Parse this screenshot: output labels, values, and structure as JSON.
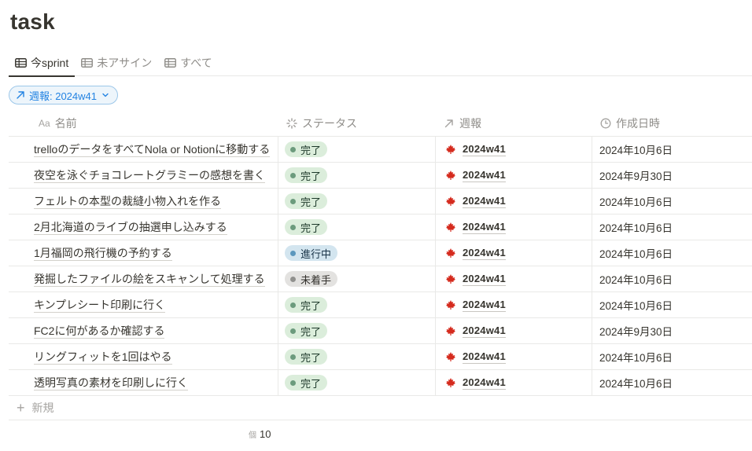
{
  "page": {
    "title": "task"
  },
  "tabs": [
    {
      "label": "今sprint",
      "active": true
    },
    {
      "label": "未アサイン",
      "active": false
    },
    {
      "label": "すべて",
      "active": false
    }
  ],
  "filter": {
    "label": "週報: 2024w41"
  },
  "columns": [
    {
      "icon": "Aa",
      "label": "名前"
    },
    {
      "icon": "status-icon",
      "label": "ステータス"
    },
    {
      "icon": "relation-arrow-icon",
      "label": "週報"
    },
    {
      "icon": "clock-icon",
      "label": "作成日時"
    }
  ],
  "status_colors": {
    "完了": {
      "bg": "#dbeddb",
      "dot": "#6c9b7d",
      "text": "#1c3829"
    },
    "進行中": {
      "bg": "#d3e5ef",
      "dot": "#5b97bd",
      "text": "#183347"
    },
    "未着手": {
      "bg": "#e3e2e0",
      "dot": "#91918e",
      "text": "#32302c"
    }
  },
  "rows": [
    {
      "name": "trelloのデータをすべてNola or Notionに移動する",
      "status": "完了",
      "report": "2024w41",
      "created": "2024年10月6日"
    },
    {
      "name": "夜空を泳ぐチョコレートグラミーの感想を書く",
      "status": "完了",
      "report": "2024w41",
      "created": "2024年9月30日"
    },
    {
      "name": "フェルトの本型の裁縫小物入れを作る",
      "status": "完了",
      "report": "2024w41",
      "created": "2024年10月6日"
    },
    {
      "name": "2月北海道のライブの抽選申し込みする",
      "status": "完了",
      "report": "2024w41",
      "created": "2024年10月6日"
    },
    {
      "name": "1月福岡の飛行機の予約する",
      "status": "進行中",
      "report": "2024w41",
      "created": "2024年10月6日"
    },
    {
      "name": "発掘したファイルの絵をスキャンして処理する",
      "status": "未着手",
      "report": "2024w41",
      "created": "2024年10月6日"
    },
    {
      "name": "キンプレシート印刷に行く",
      "status": "完了",
      "report": "2024w41",
      "created": "2024年10月6日"
    },
    {
      "name": "FC2に何があるか確認する",
      "status": "完了",
      "report": "2024w41",
      "created": "2024年9月30日"
    },
    {
      "name": "リングフィットを1回はやる",
      "status": "完了",
      "report": "2024w41",
      "created": "2024年10月6日"
    },
    {
      "name": "透明写真の素材を印刷しに行く",
      "status": "完了",
      "report": "2024w41",
      "created": "2024年10月6日"
    }
  ],
  "new_row": {
    "label": "新規"
  },
  "footer": {
    "count_label": "個",
    "count": "10"
  }
}
